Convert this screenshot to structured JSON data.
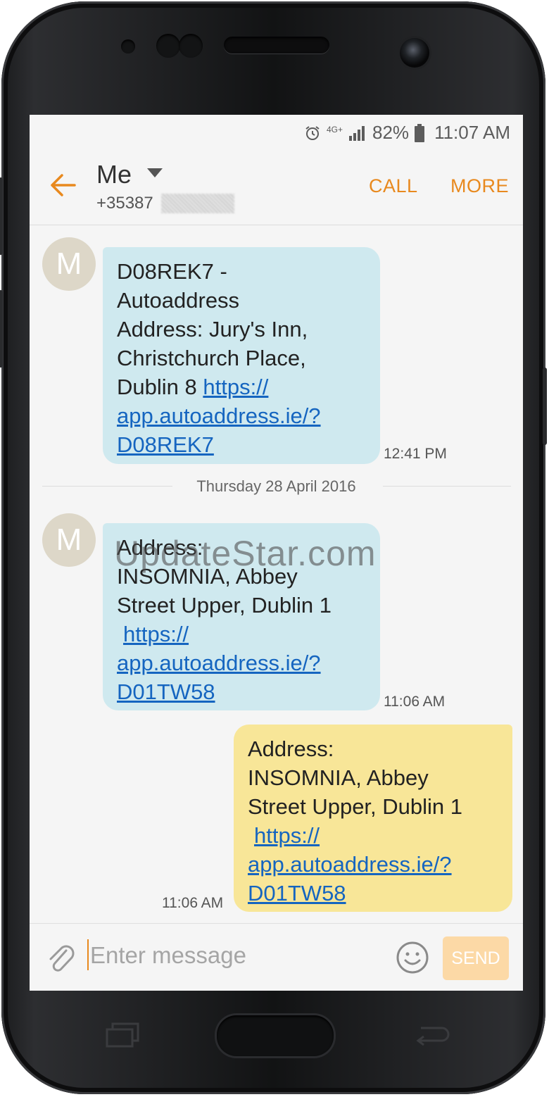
{
  "status": {
    "network": "4G+",
    "battery": "82%",
    "time": "11:07 AM",
    "icons": [
      "alarm-icon",
      "network-4g-icon",
      "signal-icon",
      "battery-icon"
    ]
  },
  "header": {
    "contact_name": "Me",
    "contact_number": "+35387",
    "call_label": "CALL",
    "more_label": "MORE"
  },
  "messages": [
    {
      "direction": "incoming",
      "avatar": "M",
      "lines": [
        "D08REK7 -",
        "Autoaddress",
        "Address: Jury's Inn,",
        "Christchurch Place,",
        "Dublin 8 "
      ],
      "link_lines": [
        "https://",
        "app.autoaddress.ie/?",
        "D08REK7"
      ],
      "time": "12:41 PM"
    },
    {
      "direction": "incoming",
      "avatar": "M",
      "lines": [
        "Address:",
        "INSOMNIA, Abbey",
        "Street Upper, Dublin 1"
      ],
      "link_lines": [
        "https://",
        "app.autoaddress.ie/?",
        "D01TW58"
      ],
      "time": "11:06 AM"
    },
    {
      "direction": "outgoing",
      "lines": [
        "Address:",
        "INSOMNIA, Abbey",
        "Street Upper, Dublin 1"
      ],
      "link_lines": [
        "https://",
        "app.autoaddress.ie/?",
        "D01TW58"
      ],
      "time": "11:06 AM"
    }
  ],
  "date_separator": "Thursday 28 April 2016",
  "watermark": "UpdateStar.com",
  "composer": {
    "placeholder": "Enter message",
    "send_label": "SEND"
  },
  "colors": {
    "accent": "#e8891e",
    "incoming_bubble": "#cfe9ef",
    "outgoing_bubble": "#f8e698",
    "link": "#1565c0",
    "avatar": "#ddd7c8"
  }
}
